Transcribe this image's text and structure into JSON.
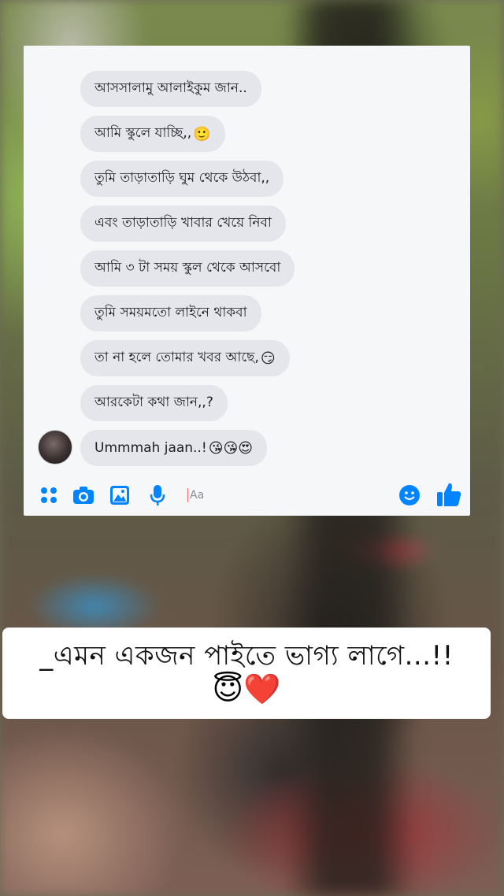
{
  "messages": [
    {
      "text": "আসসালামু আলাইকুম জান..",
      "emoji": ""
    },
    {
      "text": "আমি স্কুলে যাচ্ছি,,",
      "emoji": "🙂"
    },
    {
      "text": "তুমি তাড়াতাড়ি ঘুম থেকে উঠবা,,",
      "emoji": ""
    },
    {
      "text": "এবং তাড়াতাড়ি খাবার খেয়ে নিবা",
      "emoji": ""
    },
    {
      "text": "আমি ৩ টা সময় স্কুল থেকে আসবো",
      "emoji": ""
    },
    {
      "text": "তুমি সময়মতো লাইনে থাকবা",
      "emoji": ""
    },
    {
      "text": "তা না হলে তোমার খবর আছে,",
      "emoji": "😏"
    },
    {
      "text": "আরকেটা কথা জান,,?",
      "emoji": ""
    },
    {
      "text": "Ummmah jaan..!",
      "emoji": "😘😘😍"
    }
  ],
  "composer": {
    "placeholder": "Aa",
    "icons": [
      "apps-icon",
      "camera-icon",
      "gallery-icon",
      "microphone-icon",
      "emoji-icon",
      "like-icon"
    ],
    "accent": "#0084ff"
  },
  "caption": {
    "text": "_এমন একজন পাইতে ভাগ্য লাগে...!!",
    "emojis": "😇❤️"
  }
}
